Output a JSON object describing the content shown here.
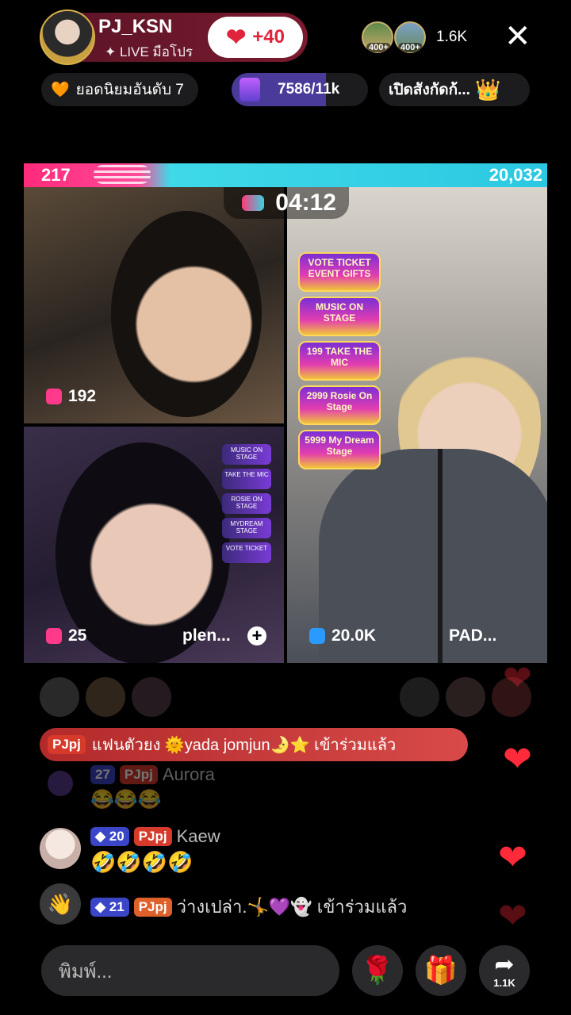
{
  "header": {
    "host_name": "PJ_KSN",
    "host_sub": "✦ LIVE มือโปร",
    "like_count": "+40",
    "viewer_badges": [
      "400+",
      "400+"
    ],
    "viewer_count": "1.6K",
    "close": "✕"
  },
  "chips": {
    "rank": "ยอดนิยมอันดับ 7",
    "progress": "7586/11k",
    "progress_fraction": 0.69,
    "open_label": "เปิดสังกัดก้..."
  },
  "battle": {
    "score_left": "217",
    "score_right": "20,032",
    "timer": "04:12",
    "left_fraction": 0.22
  },
  "panels": {
    "p1_count": "192",
    "p2_count": "25",
    "p2_name": "plen...",
    "p3_count": "20.0K",
    "p3_name": "PAD..."
  },
  "gifts": {
    "big": [
      "VOTE TICKET EVENT GIFTS",
      "MUSIC ON STAGE",
      "199 TAKE THE MIC",
      "2999 Rosie On Stage",
      "5999 My Dream Stage"
    ],
    "mini": [
      "MUSIC ON STAGE",
      "TAKE THE MIC",
      "ROSIE ON STAGE",
      "MYDREAM STAGE",
      "VOTE TICKET"
    ]
  },
  "chat": {
    "banner_tag": "PJpj",
    "banner_text": "แฟนตัวยง 🌞yada jomjun🌛⭐ เข้าร่วมแล้ว",
    "faded_level": "27",
    "faded_tag": "PJpj",
    "faded_name": "Aurora",
    "faded_msg": "😂😂😂",
    "msg1_level": "20",
    "msg1_tag": "PJpj",
    "msg1_name": "Kaew",
    "msg1_text": "🤣🤣🤣🤣",
    "msg2_level": "21",
    "msg2_tag": "PJpj",
    "msg2_text": "ว่างเปล่า.🤸💜👻 เข้าร่วมแล้ว"
  },
  "bottom": {
    "input_placeholder": "พิมพ์...",
    "share_count": "1.1K"
  }
}
